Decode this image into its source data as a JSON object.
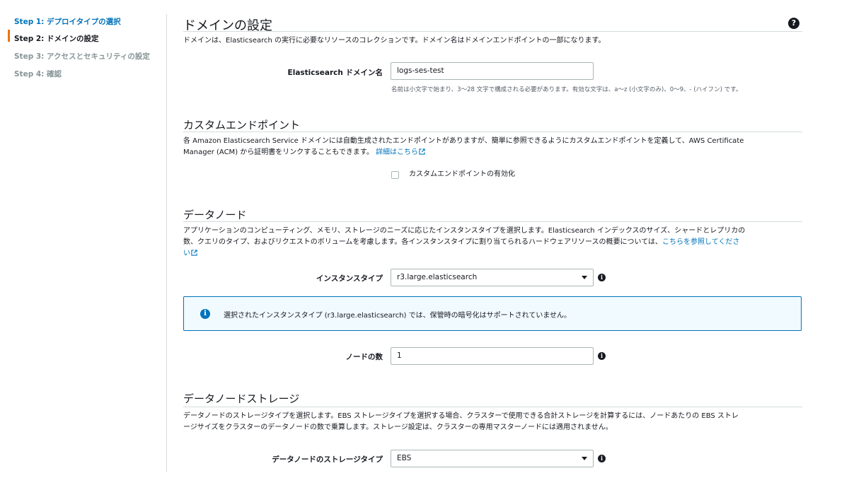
{
  "sidebar": {
    "steps": [
      {
        "label": "Step 1: デプロイタイプの選択"
      },
      {
        "label": "Step 2: ドメインの設定"
      },
      {
        "label": "Step 3: アクセスとセキュリティの設定"
      },
      {
        "label": "Step 4: 確認"
      }
    ]
  },
  "domain": {
    "title": "ドメインの設定",
    "description": "ドメインは、Elasticsearch の実行に必要なリソースのコレクションです。ドメイン名はドメインエンドポイントの一部になります。",
    "name_label": "Elasticsearch ドメイン名",
    "name_value": "logs-ses-test",
    "name_hint": "名前は小文字で始まり、3〜28 文字で構成される必要があります。有効な文字は、a〜z (小文字のみ)、0〜9、- (ハイフン) です。"
  },
  "custom_endpoint": {
    "title": "カスタムエンドポイント",
    "description_line1": "各 Amazon Elasticsearch Service ドメインには自動生成されたエンドポイントがありますが、簡単に参照できるようにカスタムエンドポイントを定義して、AWS Certificate",
    "description_line2": "Manager (ACM) から証明書をリンクすることもできます。",
    "link": "詳細はこちら",
    "checkbox_label": "カスタムエンドポイントの有効化"
  },
  "data_node": {
    "title": "データノード",
    "description_line1": "アプリケーションのコンピューティング、メモリ、ストレージのニーズに応じたインスタンスタイプを選択します。Elasticsearch インデックスのサイズ、シャードとレプリカの",
    "description_line2": "数、クエリのタイプ、およびリクエストのボリュームを考慮します。各インスタンスタイプに割り当てられるハードウェアリソースの概要については、",
    "link_part1": "こちらを参照してくださ",
    "link_part2": "い",
    "instance_type_label": "インスタンスタイプ",
    "instance_type_value": "r3.large.elasticsearch",
    "alert_text": "選択されたインスタンスタイプ (r3.large.elasticsearch) では、保管時の暗号化はサポートされていません。",
    "node_count_label": "ノードの数",
    "node_count_value": "1"
  },
  "storage": {
    "title": "データノードストレージ",
    "description_line1": "データノードのストレージタイプを選択します。EBS ストレージタイプを選択する場合、クラスターで使用できる合計ストレージを計算するには、ノードあたりの EBS ストレ",
    "description_line2": "ージサイズをクラスターのデータノードの数で乗算します。ストレージ設定は、クラスターの専用マスターノードには適用されません。",
    "storage_type_label": "データノードのストレージタイプ",
    "storage_type_value": "EBS"
  },
  "icons": {
    "help": "?",
    "info": "i"
  },
  "colors": {
    "link": "#0073bb",
    "active_step": "#ec7211",
    "alert_border": "#0073bb",
    "alert_bg": "#f1faff"
  }
}
